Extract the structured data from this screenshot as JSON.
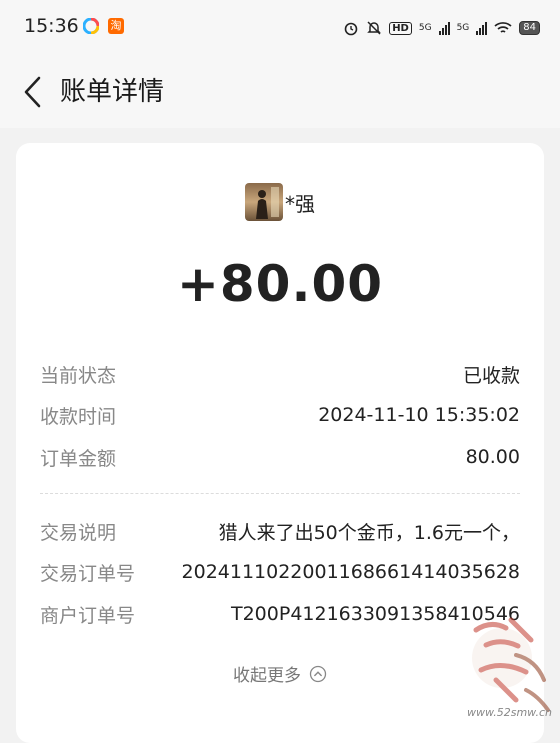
{
  "status_bar": {
    "time": "15:36",
    "battery": "84",
    "network_1": "5G",
    "network_2": "5G",
    "hd_label": "HD"
  },
  "header": {
    "title": "账单详情"
  },
  "payer": {
    "name": "*强"
  },
  "amount": "+80.00",
  "details": [
    {
      "label": "当前状态",
      "value": "已收款"
    },
    {
      "label": "收款时间",
      "value": "2024-11-10 15:35:02"
    },
    {
      "label": "订单金额",
      "value": "80.00"
    }
  ],
  "transaction": [
    {
      "label": "交易说明",
      "value": "猎人来了出50个金币，1.6元一个，"
    },
    {
      "label": "交易订单号",
      "value": "20241110220011686614140356​28"
    },
    {
      "label": "商户订单号",
      "value": "T200P41216330913584​10546"
    }
  ],
  "collapse_label": "收起更多",
  "watermark_url": "www.52smw.cn",
  "icons": {
    "back": "chevron-left-icon",
    "collapse": "chevron-up-circle-icon",
    "alarm": "alarm-icon",
    "mute": "bell-off-icon",
    "wifi": "wifi-icon"
  }
}
